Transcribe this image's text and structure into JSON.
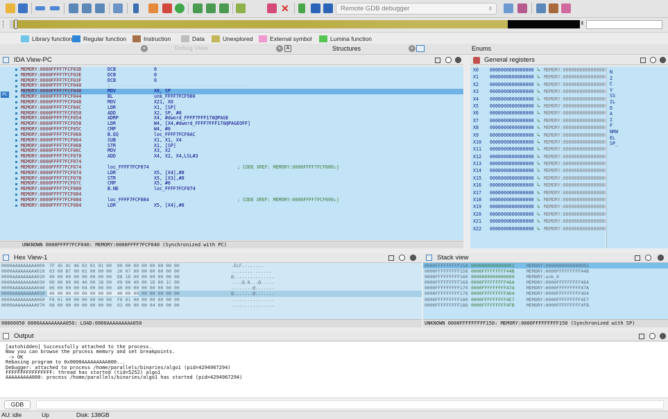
{
  "toolbar": {
    "debugger": "Remote GDB debugger",
    "icons": [
      "open-icon",
      "save-icon",
      "back-icon",
      "forward-icon",
      "folder-icon",
      "function-icon",
      "segment-icon",
      "jump-icon",
      "cursor-icon",
      "search-icon",
      "graph-icon",
      "color-icon",
      "add-icon",
      "watch-icon",
      "edit-icon",
      "window-icon",
      "breakpoint-icon",
      "stop-icon",
      "run-icon",
      "pause-icon",
      "terminate-icon"
    ]
  },
  "legend": [
    {
      "label": "Library function",
      "color": "#6fc6e6"
    },
    {
      "label": "Regular function",
      "color": "#2f86d8"
    },
    {
      "label": "Instruction",
      "color": "#a7704a"
    },
    {
      "label": "Data",
      "color": "#bdbdbd"
    },
    {
      "label": "Unexplored",
      "color": "#c4b75a"
    },
    {
      "label": "External symbol",
      "color": "#f09ad2"
    },
    {
      "label": "Lumina function",
      "color": "#56c552"
    }
  ],
  "tabs": {
    "debug_view": "Debug View",
    "structures": "Structures",
    "enums": "Enums"
  },
  "ida": {
    "title": "IDA View-PC",
    "lines": [
      {
        "addr": "MEMORY:0000FFFF7FCF03D",
        "mn": "DCB",
        "op": "0",
        "cm": ""
      },
      {
        "addr": "MEMORY:0000FFFF7FCF03E",
        "mn": "DCB",
        "op": "0",
        "cm": ""
      },
      {
        "addr": "MEMORY:0000FFFF7FCF03F",
        "mn": "DCB",
        "op": "0",
        "cm": ""
      },
      {
        "addr": "MEMORY:0000FFFF7FCF040",
        "mn": ";",
        "op": "-------------------------------------------------------------------------------",
        "cm": ""
      },
      {
        "addr": "MEMORY:0000FFFF7FCF040",
        "mn": "MOV",
        "op": "X0, SP",
        "cm": ""
      },
      {
        "addr": "MEMORY:0000FFFF7FCF044",
        "mn": "BL",
        "op": "unk_FFFF7FCF900",
        "cm": ""
      },
      {
        "addr": "MEMORY:0000FFFF7FCF048",
        "mn": "MOV",
        "op": "X21, X0",
        "cm": ""
      },
      {
        "addr": "MEMORY:0000FFFF7FCF04C",
        "mn": "LDR",
        "op": "X1, [SP]",
        "cm": ""
      },
      {
        "addr": "MEMORY:0000FFFF7FCF050",
        "mn": "ADD",
        "op": "X2, SP, #8",
        "cm": ""
      },
      {
        "addr": "MEMORY:0000FFFF7FCF054",
        "mn": "ADRP",
        "op": "X4, #dword_FFFF7FFF170@PAGE",
        "cm": ""
      },
      {
        "addr": "MEMORY:0000FFFF7FCF058",
        "mn": "LDR",
        "op": "W4, [X4,#dword_FFFF7FFF170@PAGEOFF]",
        "cm": ""
      },
      {
        "addr": "MEMORY:0000FFFF7FCF05C",
        "mn": "CMP",
        "op": "W4, #0",
        "cm": ""
      },
      {
        "addr": "MEMORY:0000FFFF7FCF060",
        "mn": "B.EQ",
        "op": "loc_FFFF7FCF0AC",
        "cm": ""
      },
      {
        "addr": "MEMORY:0000FFFF7FCF064",
        "mn": "SUB",
        "op": "X1, X1, X4",
        "cm": ""
      },
      {
        "addr": "MEMORY:0000FFFF7FCF068",
        "mn": "STR",
        "op": "X1, [SP]",
        "cm": ""
      },
      {
        "addr": "MEMORY:0000FFFF7FCF06C",
        "mn": "MOV",
        "op": "X3, X2",
        "cm": ""
      },
      {
        "addr": "MEMORY:0000FFFF7FCF070",
        "mn": "ADD",
        "op": "X4, X2, X4,LSL#3",
        "cm": ""
      },
      {
        "addr": "MEMORY:0000FFFF7FCF074",
        "mn": "",
        "op": "",
        "cm": ""
      },
      {
        "addr": "MEMORY:0000FFFF7FCF074",
        "mn": "loc_FFFF7FCF074",
        "op": "",
        "cm": "; CODE XREF: MEMORY:0000FFFF7FCF080↓j"
      },
      {
        "addr": "MEMORY:0000FFFF7FCF074",
        "mn": "LDR",
        "op": "X5, [X4],#8",
        "cm": ""
      },
      {
        "addr": "MEMORY:0000FFFF7FCF078",
        "mn": "STR",
        "op": "X5, [X3],#8",
        "cm": ""
      },
      {
        "addr": "MEMORY:0000FFFF7FCF07C",
        "mn": "CMP",
        "op": "X5, #0",
        "cm": ""
      },
      {
        "addr": "MEMORY:0000FFFF7FCF080",
        "mn": "B.NE",
        "op": "loc_FFFF7FCF074",
        "cm": ""
      },
      {
        "addr": "MEMORY:0000FFFF7FCF084",
        "mn": "",
        "op": "",
        "cm": ""
      },
      {
        "addr": "MEMORY:0000FFFF7FCF084",
        "mn": "loc_FFFF7FCF084",
        "op": "",
        "cm": "; CODE XREF: MEMORY:0000FFFF7FCF090↓j"
      },
      {
        "addr": "MEMORY:0000FFFF7FCF084",
        "mn": "LDR",
        "op": "X5, [X4],#8",
        "cm": ""
      }
    ],
    "status": "UNKNOWN 0000FFFF7FCF040: MEMORY:0000FFFF7FCF040 (Synchronized with PC)"
  },
  "registers": {
    "title": "General registers",
    "rows": [
      {
        "name": "X0",
        "value": "0000000000000000",
        "ref": "MEMORY:0000000000000000"
      },
      {
        "name": "X1",
        "value": "0000000000000000",
        "ref": "MEMORY:0000000000000000"
      },
      {
        "name": "X2",
        "value": "0000000000000000",
        "ref": "MEMORY:0000000000000000"
      },
      {
        "name": "X3",
        "value": "0000000000000000",
        "ref": "MEMORY:0000000000000000"
      },
      {
        "name": "X4",
        "value": "0000000000000000",
        "ref": "MEMORY:0000000000000000"
      },
      {
        "name": "X5",
        "value": "0000000000000000",
        "ref": "MEMORY:0000000000000000"
      },
      {
        "name": "X6",
        "value": "0000000000000000",
        "ref": "MEMORY:0000000000000000"
      },
      {
        "name": "X7",
        "value": "0000000000000000",
        "ref": "MEMORY:0000000000000000"
      },
      {
        "name": "X8",
        "value": "0000000000000000",
        "ref": "MEMORY:0000000000000000"
      },
      {
        "name": "X9",
        "value": "0000000000000000",
        "ref": "MEMORY:0000000000000000"
      },
      {
        "name": "X10",
        "value": "0000000000000000",
        "ref": "MEMORY:0000000000000000"
      },
      {
        "name": "X11",
        "value": "0000000000000000",
        "ref": "MEMORY:0000000000000000"
      },
      {
        "name": "X12",
        "value": "0000000000000000",
        "ref": "MEMORY:0000000000000000"
      },
      {
        "name": "X13",
        "value": "0000000000000000",
        "ref": "MEMORY:0000000000000000"
      },
      {
        "name": "X14",
        "value": "0000000000000000",
        "ref": "MEMORY:0000000000000000"
      },
      {
        "name": "X15",
        "value": "0000000000000000",
        "ref": "MEMORY:0000000000000000"
      },
      {
        "name": "X16",
        "value": "0000000000000000",
        "ref": "MEMORY:0000000000000000"
      },
      {
        "name": "X17",
        "value": "0000000000000000",
        "ref": "MEMORY:0000000000000000"
      },
      {
        "name": "X18",
        "value": "0000000000000000",
        "ref": "MEMORY:0000000000000000"
      },
      {
        "name": "X19",
        "value": "0000000000000000",
        "ref": "MEMORY:0000000000000000"
      },
      {
        "name": "X20",
        "value": "0000000000000000",
        "ref": "MEMORY:0000000000000000"
      },
      {
        "name": "X21",
        "value": "0000000000000000",
        "ref": "MEMORY:0000000000000000"
      },
      {
        "name": "X22",
        "value": "0000000000000000",
        "ref": "MEMORY:0000000000000000"
      }
    ],
    "flags": [
      "N",
      "Z",
      "C",
      "V",
      "SS",
      "IL",
      "D",
      "A",
      "I",
      "F",
      "NRW",
      "EL",
      "SP_"
    ]
  },
  "hex": {
    "title": "Hex View-1",
    "rows": [
      {
        "addr": "0000AAAAAAAAA000",
        "bytes": "7F 45 4C 46 02 01 01 00  00 00 00 00 00 00 00 00",
        "ascii": ".ELF........"
      },
      {
        "addr": "0000AAAAAAAAA010",
        "bytes": "03 00 B7 00 01 00 00 00  20 07 00 00 00 00 00 00",
        "ascii": "........ ......"
      },
      {
        "addr": "0000AAAAAAAAA020",
        "bytes": "40 00 00 00 00 00 00 00  D8 1D 00 00 00 00 00 00",
        "ascii": "@..............."
      },
      {
        "addr": "0000AAAAAAAAA030",
        "bytes": "00 00 00 00 40 00 38 00  09 00 40 00 1D 00 1C 00",
        "ascii": "....@.8...@....."
      },
      {
        "addr": "0000AAAAAAAAA040",
        "bytes": "06 00 00 00 04 00 00 00  40 00 00 00 00 00 00 00",
        "ascii": "........@......."
      },
      {
        "addr": "0000AAAAAAAAA050",
        "bytes": "40 00 00 00 00 00 00 00  40 00 00 00 00 00 00 00",
        "ascii": "@.......@......."
      },
      {
        "addr": "0000AAAAAAAAA060",
        "bytes": "F8 01 00 00 00 00 00 00  F8 01 00 00 00 00 00 00",
        "ascii": "................"
      },
      {
        "addr": "0000AAAAAAAAA070",
        "bytes": "08 00 00 00 00 00 00 00  03 00 00 00 04 00 00 00",
        "ascii": "................"
      }
    ],
    "status": "00000050 0000AAAAAAAAA050: LOAD:0000AAAAAAAAA050"
  },
  "stack": {
    "title": "Stack view",
    "rows": [
      {
        "addr": "0000FFFFFFFFF150",
        "val": "0000000000000001",
        "ref": "MEMORY:0000000000000001"
      },
      {
        "addr": "0000FFFFFFFFF158",
        "val": "0000FFFFFFFFF44B",
        "ref": "MEMORY:0000FFFFFFFFF44B"
      },
      {
        "addr": "0000FFFFFFFFF160",
        "val": "0000000000000000",
        "ref": "MEMORY:unk_0"
      },
      {
        "addr": "0000FFFFFFFFF168",
        "val": "0000FFFFFFFFF46A",
        "ref": "MEMORY:0000FFFFFFFFF46A"
      },
      {
        "addr": "0000FFFFFFFFF170",
        "val": "0000FFFFFFFFF47A",
        "ref": "MEMORY:0000FFFFFFFFF47A"
      },
      {
        "addr": "0000FFFFFFFFF178",
        "val": "0000FFFFFFFFF4D4",
        "ref": "MEMORY:0000FFFFFFFFF4D4"
      },
      {
        "addr": "0000FFFFFFFFF180",
        "val": "0000FFFFFFFFF4E7",
        "ref": "MEMORY:0000FFFFFFFFF4E7"
      },
      {
        "addr": "0000FFFFFFFFF188",
        "val": "0000FFFFFFFFF4FB",
        "ref": "MEMORY:0000FFFFFFFFF4FB"
      }
    ],
    "status": "UNKNOWN 0000FFFFFFFFF150: MEMORY:0000FFFFFFFFF150 (Synchronized with SP)"
  },
  "output": {
    "title": "Output",
    "lines": [
      "[autohidden] Successfully attached to the process.",
      "Now you can browse the process memory and set breakpoints.",
      " -> OK",
      "Rebasing program to 0x0000AAAAAAAAA000...",
      "Debugger: attached to process /home/parallels/binaries/algo1 (pid=4294967294)",
      "FFFFFFFFFFFFFFFF: thread has started (tid=5252) algo1",
      "AAAAAAAAA000: process /home/parallels/binaries/algo1 has started (pid=4294967294)"
    ],
    "cli_button": "GDB"
  },
  "status": {
    "au": "AU:",
    "state": "idle",
    "direction": "Up",
    "disk": "Disk: 138GB"
  }
}
